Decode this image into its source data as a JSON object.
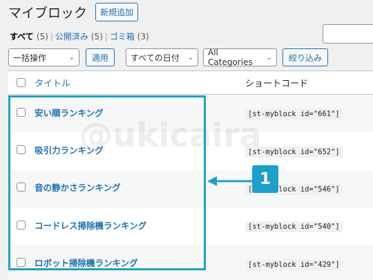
{
  "header": {
    "title": "マイブロック",
    "add_new": "新規追加"
  },
  "filters": {
    "all": {
      "label": "すべて",
      "count": "(5)"
    },
    "published": {
      "label": "公開済み",
      "count": "(5)"
    },
    "trash": {
      "label": "ゴミ箱",
      "count": "(3)"
    },
    "separator": "|"
  },
  "tablenav": {
    "bulk_action": "一括操作",
    "apply": "適用",
    "dates": "すべての日付",
    "categories": "All Categories",
    "filter": "絞り込み"
  },
  "table": {
    "col_title": "タイトル",
    "col_code": "ショートコード",
    "rows": [
      {
        "title": "安い順ランキング",
        "code": "[st-myblock id=\"661\"]"
      },
      {
        "title": "吸引力ランキング",
        "code": "[st-myblock id=\"652\"]"
      },
      {
        "title": "音の静かさランキング",
        "code": "[st-myblock id=\"546\"]"
      },
      {
        "title": "コードレス掃除機ランキング",
        "code": "[st-myblock id=\"540\"]"
      },
      {
        "title": "ロボット掃除機ランキング",
        "code": "[st-myblock id=\"429\"]"
      }
    ]
  },
  "annotation": {
    "badge": "1",
    "color": "#1e9fc9"
  },
  "watermark": "@ukicaira",
  "colors": {
    "link": "#2271b1",
    "accent": "#1e9fc9"
  }
}
